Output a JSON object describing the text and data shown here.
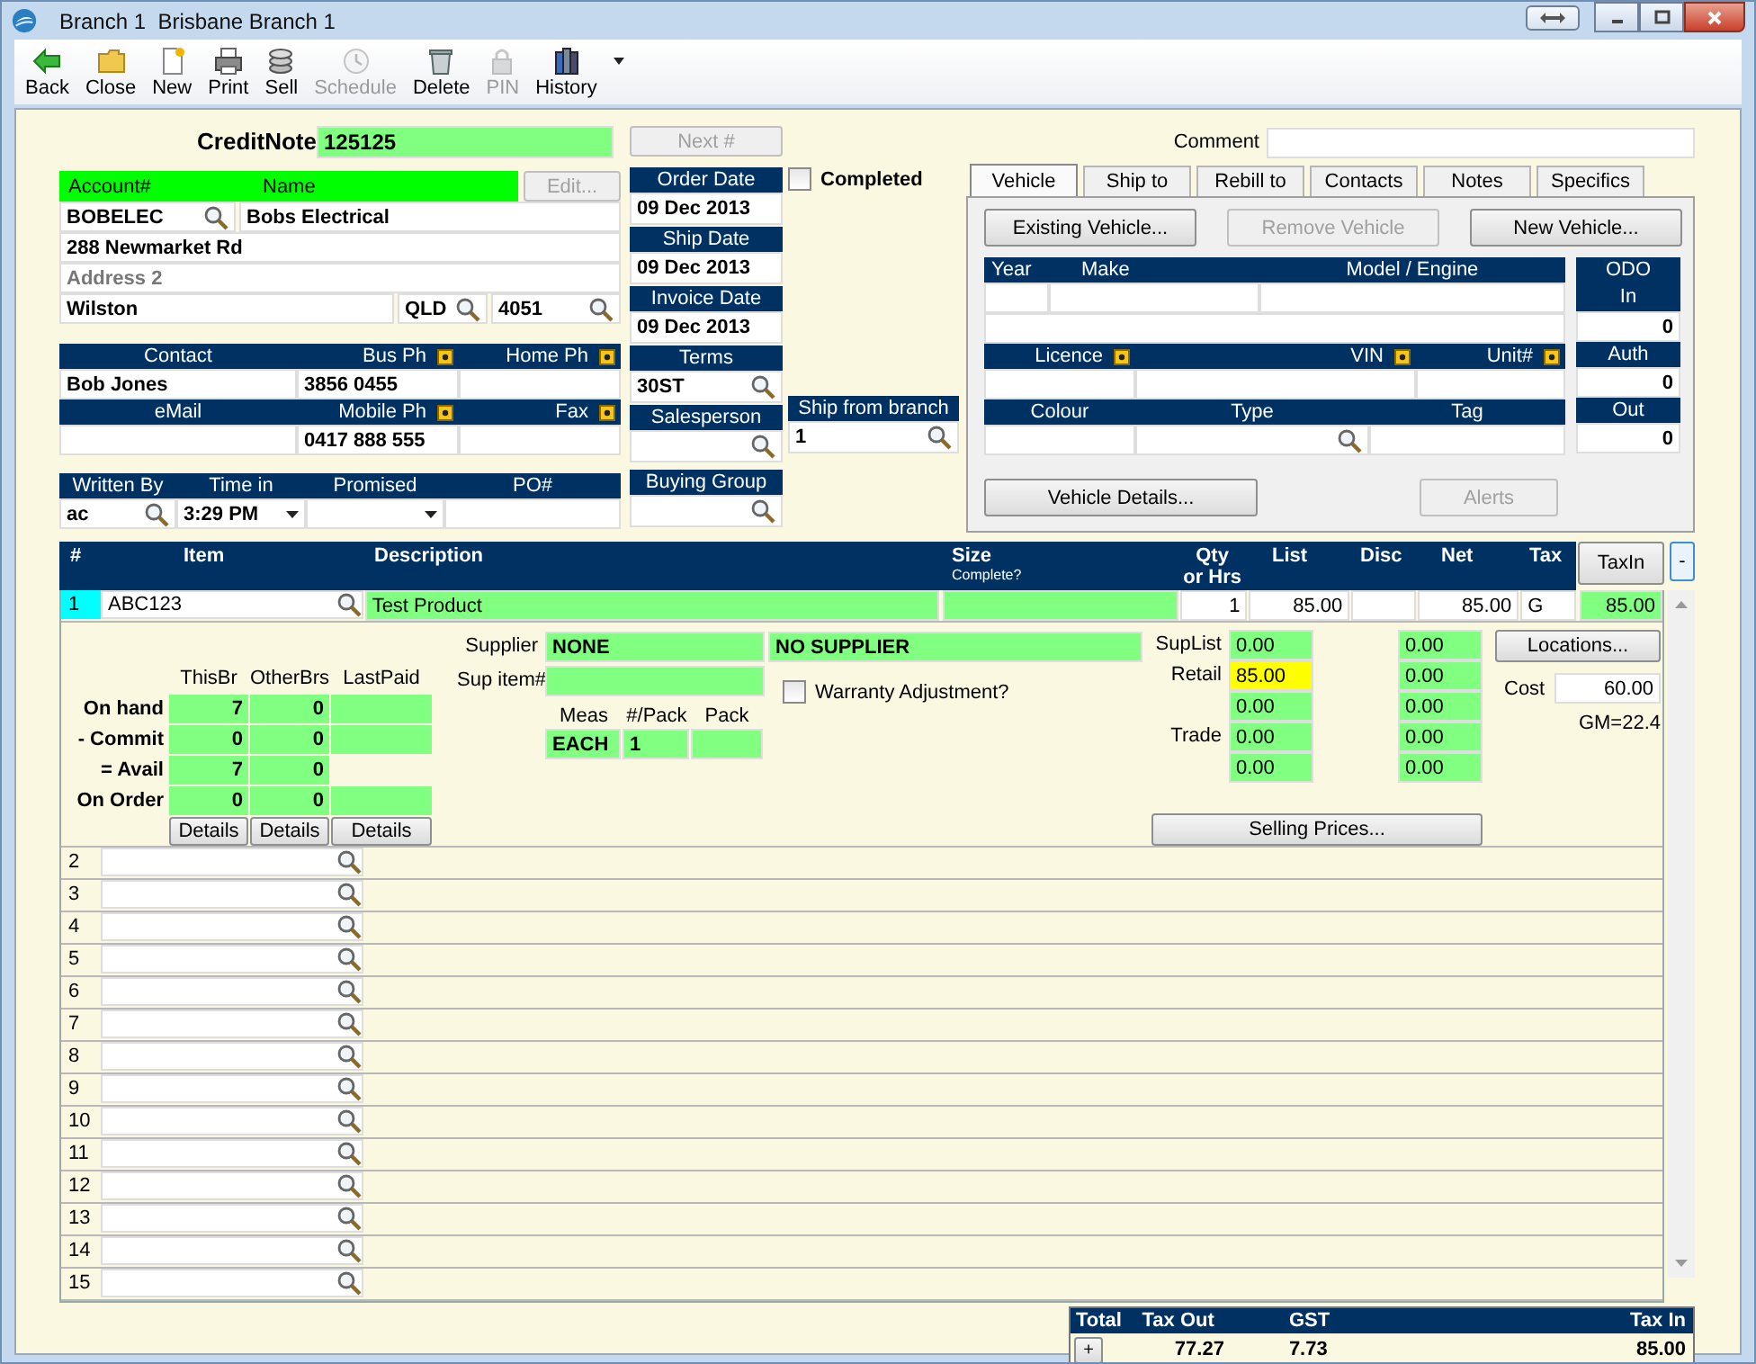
{
  "window": {
    "title": "Branch 1  Brisbane Branch 1"
  },
  "toolbar": [
    {
      "label": "Back",
      "disabled": false
    },
    {
      "label": "Close",
      "disabled": false
    },
    {
      "label": "New",
      "disabled": false
    },
    {
      "label": "Print",
      "disabled": false
    },
    {
      "label": "Sell",
      "disabled": false
    },
    {
      "label": "Schedule",
      "disabled": true
    },
    {
      "label": "Delete",
      "disabled": false
    },
    {
      "label": "PIN",
      "disabled": true
    },
    {
      "label": "History",
      "disabled": false
    }
  ],
  "document": {
    "label": "CreditNote",
    "number": "125125",
    "next_button": {
      "label": "Next #",
      "disabled": true
    }
  },
  "comment": {
    "label": "Comment"
  },
  "customer": {
    "header": [
      "Account#",
      "Name"
    ],
    "edit_button": {
      "label": "Edit...",
      "disabled": true
    },
    "account": "BOBELEC",
    "name": "Bobs Electrical",
    "address_1": "288 Newmarket Rd",
    "address_2": {
      "placeholder": "Address 2"
    },
    "city": "Wilston",
    "state": "QLD",
    "postcode": "4051"
  },
  "contact": [
    {
      "headers": [
        {
          "label": "Contact",
          "flag": false
        },
        {
          "label": "Bus Ph",
          "flag": true
        },
        {
          "label": "Home Ph",
          "flag": true
        }
      ],
      "values": {
        "col_1": "Bob Jones",
        "col_2": "3856 0455"
      }
    },
    {
      "headers": [
        {
          "label": "eMail",
          "flag": false
        },
        {
          "label": "Mobile Ph",
          "flag": true
        },
        {
          "label": "Fax",
          "flag": true
        }
      ],
      "values": {
        "col_2": "0417 888 555"
      }
    }
  ],
  "order": {
    "headers": [
      "Written By",
      "Time in",
      "Promised",
      "PO#"
    ],
    "written_by": "ac",
    "time_in": "3:29 PM"
  },
  "dates": [
    {
      "label": "Order Date",
      "value": "09 Dec 2013",
      "lookup": false
    },
    {
      "label": "Ship Date",
      "value": "09 Dec 2013",
      "lookup": false
    },
    {
      "label": "Invoice Date",
      "value": "09 Dec 2013",
      "lookup": false
    },
    {
      "label": "Terms",
      "value": "30ST",
      "lookup": true
    },
    {
      "label": "Salesperson",
      "lookup": true
    }
  ],
  "buying_group": {
    "label": "Buying Group"
  },
  "completed": {
    "label": "Completed",
    "checked": false
  },
  "ship_from_branch": {
    "label": "Ship from branch",
    "value": "1"
  },
  "tabs": [
    {
      "label": "Vehicle",
      "selected": true
    },
    {
      "label": "Ship to",
      "selected": false
    },
    {
      "label": "Rebill to",
      "selected": false
    },
    {
      "label": "Contacts",
      "selected": false
    },
    {
      "label": "Notes",
      "selected": false
    },
    {
      "label": "Specifics",
      "selected": false
    }
  ],
  "vehicle": {
    "buttons": [
      {
        "label": "Existing Vehicle...",
        "disabled": false
      },
      {
        "label": "Remove Vehicle",
        "disabled": true
      },
      {
        "label": "New Vehicle...",
        "disabled": false
      }
    ],
    "grid": [
      {
        "headers": [
          {
            "label": "Year",
            "flag": false
          },
          {
            "label": "Make",
            "flag": false
          },
          {
            "label": "Model / Engine",
            "flag": false
          }
        ]
      },
      {
        "headers": [
          {
            "label": "Licence",
            "flag": true
          },
          {
            "label": "VIN",
            "flag": true
          },
          {
            "label": "Unit#",
            "flag": true
          }
        ]
      },
      {
        "headers": [
          {
            "label": "Colour",
            "flag": false
          },
          {
            "label": "Type",
            "flag": false
          },
          {
            "label": "Tag",
            "flag": false
          }
        ]
      }
    ],
    "odometer": [
      {
        "label": "ODO\nIn",
        "value": "0"
      },
      {
        "label": "Auth",
        "value": "0"
      },
      {
        "label": "Out",
        "value": "0"
      }
    ],
    "details_button": {
      "label": "Vehicle Details...",
      "disabled": false
    },
    "alerts_button": {
      "label": "Alerts",
      "disabled": true
    }
  },
  "lines": {
    "columns": [
      {
        "label": "#"
      },
      {
        "label": "Item"
      },
      {
        "label": "Description"
      },
      {
        "label": "Size",
        "note": "Complete?"
      },
      {
        "label": "Qty\nor Hrs"
      },
      {
        "label": "List"
      },
      {
        "label": "Disc"
      },
      {
        "label": "Net"
      },
      {
        "label": "Tax"
      }
    ],
    "tax_button": "TaxIn",
    "collapse_button": "-",
    "rows": [
      {
        "num": "1",
        "selected": true,
        "expanded": true,
        "item": "ABC123",
        "description": "Test Product",
        "qty": "1",
        "list": "85.00",
        "net": "85.00",
        "tax": "G",
        "tax_in": "85.00"
      },
      {
        "num": "2",
        "selected": false,
        "expanded": false
      },
      {
        "num": "3",
        "selected": false,
        "expanded": false
      },
      {
        "num": "4",
        "selected": false,
        "expanded": false
      },
      {
        "num": "5",
        "selected": false,
        "expanded": false
      },
      {
        "num": "6",
        "selected": false,
        "expanded": false
      },
      {
        "num": "7",
        "selected": false,
        "expanded": false
      },
      {
        "num": "8",
        "selected": false,
        "expanded": false
      },
      {
        "num": "9",
        "selected": false,
        "expanded": false
      },
      {
        "num": "10",
        "selected": false,
        "expanded": false
      },
      {
        "num": "11",
        "selected": false,
        "expanded": false
      },
      {
        "num": "12",
        "selected": false,
        "expanded": false
      },
      {
        "num": "13",
        "selected": false,
        "expanded": false
      },
      {
        "num": "14",
        "selected": false,
        "expanded": false
      },
      {
        "num": "15",
        "selected": false,
        "expanded": false
      }
    ]
  },
  "stock": {
    "columns": [
      "ThisBr",
      "OtherBrs",
      "LastPaid"
    ],
    "rows": [
      {
        "label": "On hand",
        "cells": [
          {
            "text": "7"
          },
          {
            "text": "0"
          },
          {}
        ]
      },
      {
        "label": "- Commit",
        "cells": [
          {
            "text": "0"
          },
          {
            "text": "0"
          },
          {}
        ]
      },
      {
        "label": "= Avail",
        "cells": [
          {
            "text": "7"
          },
          {
            "text": "0"
          }
        ]
      },
      {
        "label": "On Order",
        "cells": [
          {
            "text": "0"
          },
          {
            "text": "0"
          },
          {}
        ]
      }
    ],
    "buttons": [
      "Details",
      "Details",
      "Details"
    ]
  },
  "supplier": {
    "label": "Supplier",
    "code": "NONE",
    "name": "NO SUPPLIER",
    "item_label": "Sup item#",
    "pack_headers": [
      "Meas",
      "#/Pack",
      "Pack"
    ],
    "meas": "EACH",
    "per_pack": "1"
  },
  "warranty": {
    "label": "Warranty Adjustment?",
    "checked": false
  },
  "prices": [
    {
      "label": "SupList",
      "value": "0.00",
      "alt": "0.00",
      "highlight": false
    },
    {
      "label": "Retail",
      "value": "85.00",
      "alt": "0.00",
      "highlight": true
    },
    {
      "value": "0.00",
      "alt": "0.00",
      "highlight": false
    },
    {
      "label": "Trade",
      "value": "0.00",
      "alt": "0.00",
      "highlight": false
    },
    {
      "value": "0.00",
      "alt": "0.00",
      "highlight": false
    }
  ],
  "selling_prices_button": "Selling Prices...",
  "locations_button": "Locations...",
  "cost": {
    "label": "Cost",
    "value": "60.00"
  },
  "margin": "GM=22.4",
  "totals": {
    "headers": [
      "Total",
      "Tax Out",
      "GST",
      "Tax In"
    ],
    "expand_button": "+",
    "tax_out": "77.27",
    "gst": "7.73",
    "tax_in": "85.00"
  }
}
